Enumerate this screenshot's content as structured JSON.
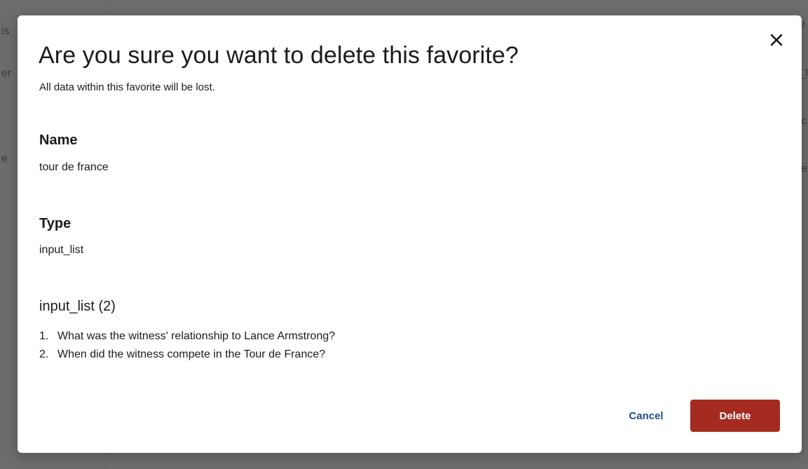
{
  "background": {
    "fragments_left": [
      "is",
      "er",
      "e"
    ],
    "fragments_right": [
      "e",
      "_I",
      "ic",
      "ie"
    ]
  },
  "modal": {
    "title": "Are you sure you want to delete this favorite?",
    "subtitle": "All data within this favorite will be lost.",
    "close_icon": "close-icon",
    "fields": [
      {
        "label": "Name",
        "value": "tour de france"
      },
      {
        "label": "Type",
        "value": "input_list"
      }
    ],
    "list": {
      "title": "input_list (2)",
      "items": [
        {
          "num": "1.",
          "text": "What was the witness' relationship to Lance Armstrong?"
        },
        {
          "num": "2.",
          "text": "When did the witness compete in the Tour de France?"
        }
      ]
    },
    "cancel_label": "Cancel",
    "delete_label": "Delete"
  },
  "colors": {
    "delete_button": "#a52b20",
    "cancel_text": "#1f4d8f",
    "overlay": "rgba(60,60,60,0.72)"
  }
}
